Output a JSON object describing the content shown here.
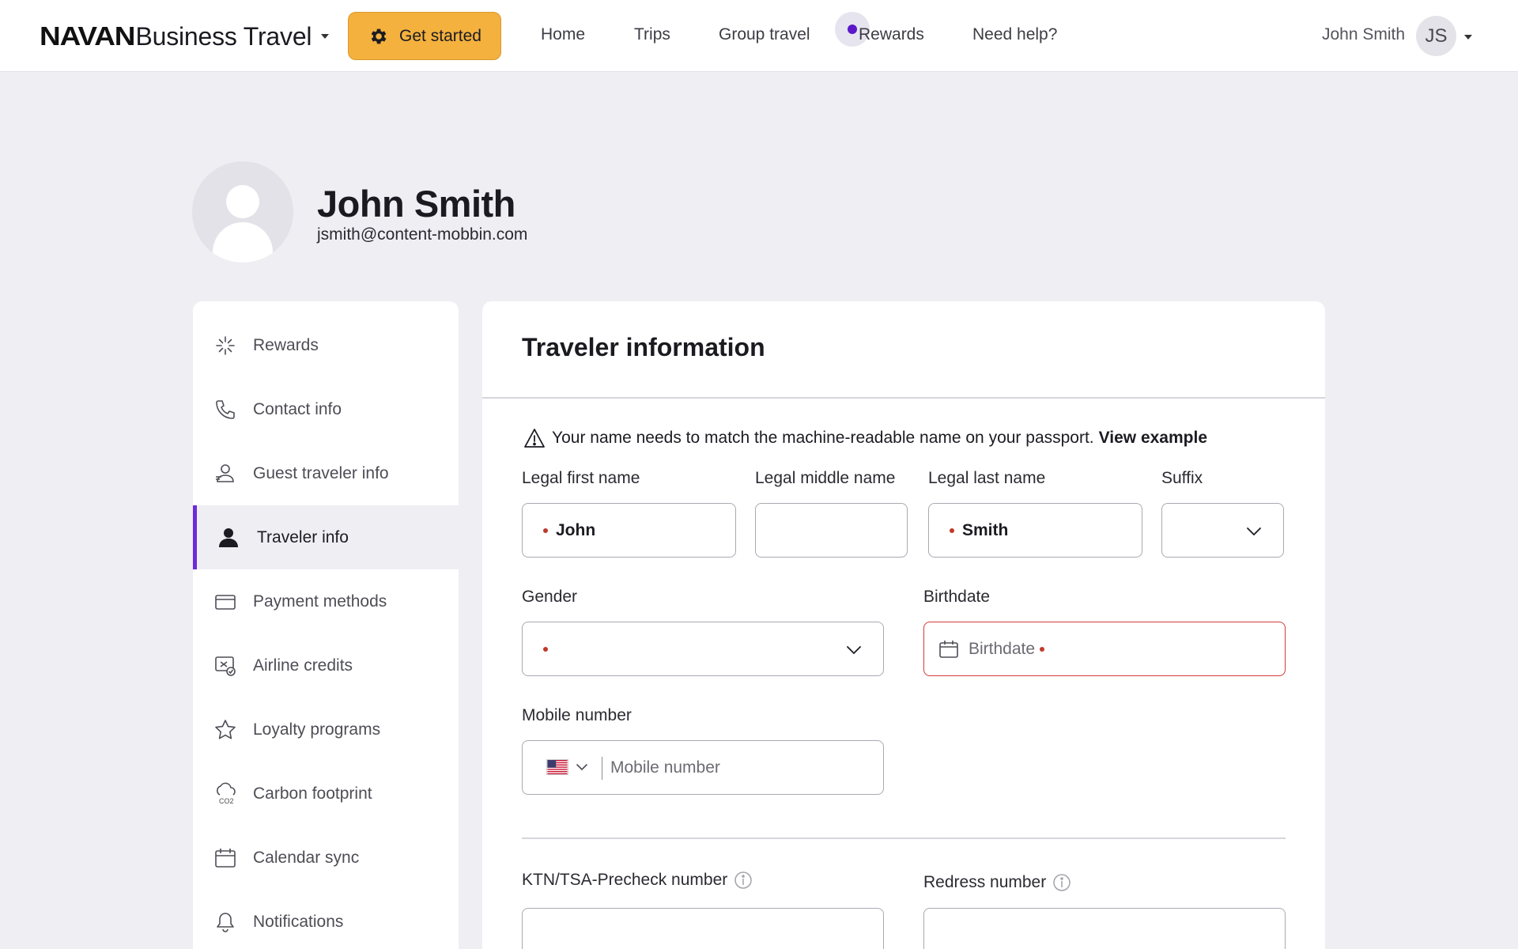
{
  "nav": {
    "brand_logo": "NAVAN",
    "brand_product": "Business Travel",
    "get_started": "Get started",
    "links": [
      "Home",
      "Trips",
      "Group travel",
      "Rewards",
      "Need help?"
    ],
    "user_name": "John Smith",
    "user_initials": "JS"
  },
  "profile": {
    "name": "John Smith",
    "email": "jsmith@content-mobbin.com"
  },
  "sidebar": {
    "items": [
      {
        "label": "Rewards",
        "icon": "sparkle-icon"
      },
      {
        "label": "Contact info",
        "icon": "phone-icon"
      },
      {
        "label": "Guest traveler info",
        "icon": "guest-icon"
      },
      {
        "label": "Traveler info",
        "icon": "person-icon",
        "active": true
      },
      {
        "label": "Payment methods",
        "icon": "credit-card-icon"
      },
      {
        "label": "Airline credits",
        "icon": "airline-credit-icon"
      },
      {
        "label": "Loyalty programs",
        "icon": "star-icon"
      },
      {
        "label": "Carbon footprint",
        "icon": "co2-icon"
      },
      {
        "label": "Calendar sync",
        "icon": "calendar-icon"
      },
      {
        "label": "Notifications",
        "icon": "bell-icon"
      }
    ]
  },
  "traveler": {
    "title": "Traveler information",
    "notice_text": "Your name needs to match the machine-readable name on your passport.",
    "notice_link": "View example",
    "labels": {
      "first": "Legal first name",
      "middle": "Legal middle name",
      "last": "Legal last name",
      "suffix": "Suffix",
      "gender": "Gender",
      "birthdate": "Birthdate",
      "mobile": "Mobile number",
      "ktn": "KTN/TSA-Precheck number",
      "redress": "Redress number"
    },
    "values": {
      "first": "John",
      "middle": "",
      "last": "Smith",
      "suffix": "",
      "gender": ""
    },
    "placeholders": {
      "birthdate": "Birthdate",
      "mobile": "Mobile number"
    },
    "phone_country": "US"
  },
  "colors": {
    "accent": "#6b2bd9",
    "cta": "#f4b13d",
    "error": "#d33a3a",
    "required_dot": "#c0392b"
  }
}
